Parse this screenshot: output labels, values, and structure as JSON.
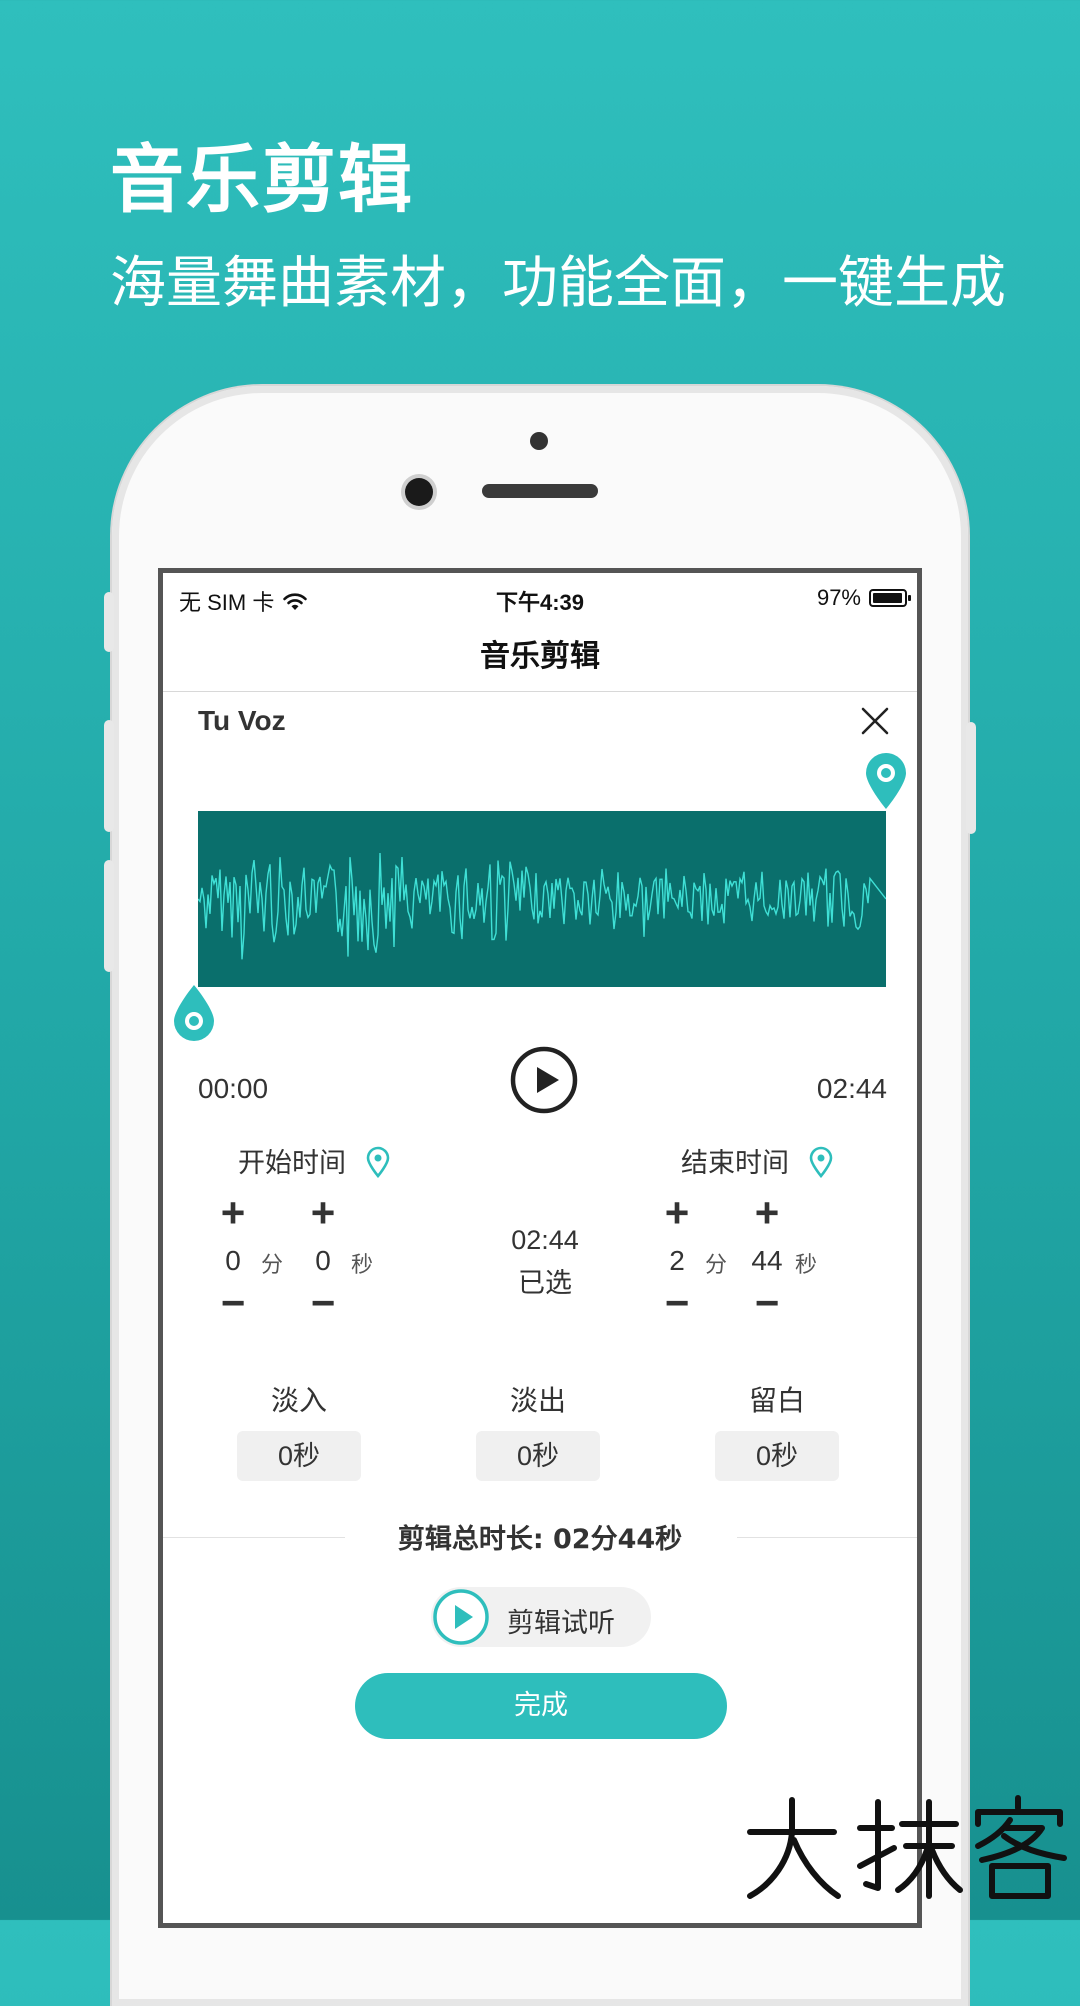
{
  "promo": {
    "title": "音乐剪辑",
    "subtitle": "海量舞曲素材，功能全面，一键生成"
  },
  "status_bar": {
    "carrier": "无 SIM 卡",
    "time": "下午4:39",
    "battery": "97%",
    "battery_level": 0.97
  },
  "nav": {
    "title": "音乐剪辑"
  },
  "song": {
    "title": "Tu Voz"
  },
  "player": {
    "start_time": "00:00",
    "end_time": "02:44"
  },
  "start_section": {
    "label": "开始时间",
    "minutes": "0",
    "minutes_unit": "分",
    "seconds": "0",
    "seconds_unit": "秒",
    "plus": "+",
    "minus": "−"
  },
  "end_section": {
    "label": "结束时间",
    "minutes": "2",
    "minutes_unit": "分",
    "seconds": "44",
    "seconds_unit": "秒",
    "plus": "+",
    "minus": "−"
  },
  "selected": {
    "duration": "02:44",
    "label": "已选"
  },
  "options": [
    {
      "label": "淡入",
      "value": "0秒"
    },
    {
      "label": "淡出",
      "value": "0秒"
    },
    {
      "label": "留白",
      "value": "0秒"
    }
  ],
  "total": {
    "text": "剪辑总时长: 02分44秒"
  },
  "preview_button": {
    "label": "剪辑试听"
  },
  "done_button": {
    "label": "完成"
  },
  "colors": {
    "accent": "#2ebebc",
    "waveform_bg": "#0a6f6c",
    "waveform_line": "#3fe0d6",
    "background": "#22a9a8"
  },
  "watermark": {
    "text": "大抹客"
  }
}
